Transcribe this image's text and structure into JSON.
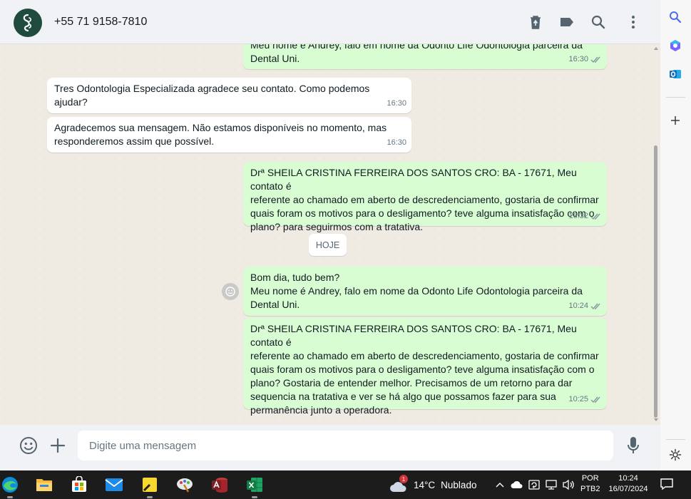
{
  "header": {
    "contact_name": "+55 71 9158-7810"
  },
  "messages": [
    {
      "direction": "out",
      "text": "Meu nome é Andrey, falo em nome da Odonto Life Odontologia parceira da\nDental Uni.",
      "time": "16:30",
      "status": "read"
    },
    {
      "direction": "in",
      "text": "Tres Odontologia Especializada agradece seu contato. Como podemos ajudar?",
      "time": "16:30"
    },
    {
      "direction": "in",
      "text": "Agradecemos sua mensagem. Não estamos disponíveis no momento, mas\nresponderemos assim que possível.",
      "time": "16:30"
    },
    {
      "direction": "out",
      "text": "Drª SHEILA CRISTINA FERREIRA DOS SANTOS CRO: BA - 17671, Meu contato é\nreferente ao chamado em aberto de descredenciamento, gostaria de confirmar\nquais foram os motivos para o desligamento? teve alguma insatisfação com o\nplano? para seguirmos com a tratativa.",
      "time": "16:32",
      "status": "read"
    },
    {
      "direction": "out",
      "text": "Bom dia, tudo bem?\nMeu nome é Andrey, falo em nome da Odonto Life Odontologia parceira da\nDental Uni.",
      "time": "10:24",
      "status": "read"
    },
    {
      "direction": "out",
      "text": "Drª SHEILA CRISTINA FERREIRA DOS SANTOS CRO: BA - 17671, Meu contato é\nreferente ao chamado em aberto de descredenciamento, gostaria de confirmar\nquais foram os motivos para o desligamento? teve alguma insatisfação com o\nplano? Gostaria de entender melhor. Precisamos de um retorno para dar\nsequencia na tratativa e ver se há algo que possamos fazer para sua\npermanência junto a operadora.",
      "time": "10:25",
      "status": "read"
    }
  ],
  "date_divider": "HOJE",
  "composer": {
    "placeholder": "Digite uma mensagem"
  },
  "icons": {
    "header": [
      "delete-icon",
      "label-icon",
      "search-icon",
      "more-icon"
    ],
    "composer": [
      "emoji-icon",
      "attach-plus-icon",
      "mic-icon"
    ],
    "sidebar": [
      "search-icon",
      "copilot-icon",
      "outlook-icon",
      "add-icon",
      "settings-icon"
    ]
  },
  "taskbar": {
    "apps": [
      "edge",
      "file-explorer",
      "microsoft-store",
      "mail",
      "sticky-notes",
      "paint",
      "access",
      "excel"
    ],
    "weather": {
      "badge": "1",
      "temperature": "14°C",
      "condition": "Nublado"
    },
    "language": {
      "line1": "POR",
      "line2": "PTB2"
    },
    "clock": {
      "time": "10:24",
      "date": "16/07/2024"
    }
  },
  "colors": {
    "outgoing_bubble": "#d9fdd3",
    "incoming_bubble": "#ffffff",
    "chat_background": "#efeae2",
    "header_background": "#f0f2f5",
    "read_check": "#8696a0"
  }
}
